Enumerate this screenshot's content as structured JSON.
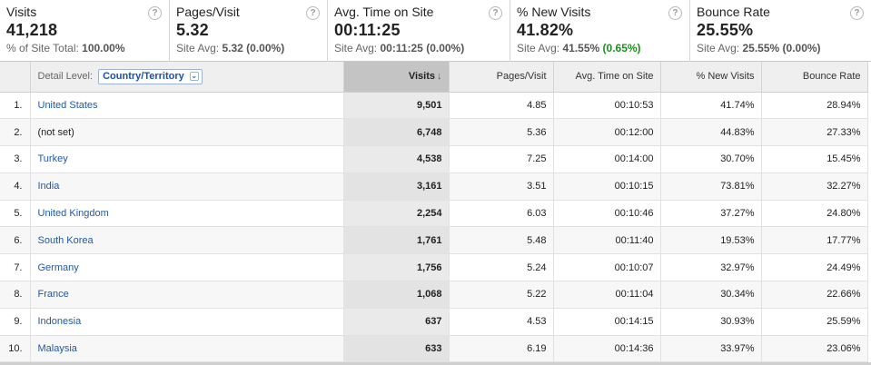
{
  "metrics": [
    {
      "label": "Visits",
      "value": "41,218",
      "sub_prefix": "% of Site Total: ",
      "sub_value": "100.00%",
      "sub_delta": ""
    },
    {
      "label": "Pages/Visit",
      "value": "5.32",
      "sub_prefix": "Site Avg: ",
      "sub_value": "5.32 (0.00%)",
      "sub_delta": ""
    },
    {
      "label": "Avg. Time on Site",
      "value": "00:11:25",
      "sub_prefix": "Site Avg: ",
      "sub_value": "00:11:25 (0.00%)",
      "sub_delta": ""
    },
    {
      "label": "% New Visits",
      "value": "41.82%",
      "sub_prefix": "Site Avg: ",
      "sub_value": "41.55%",
      "sub_delta": "(0.65%)"
    },
    {
      "label": "Bounce Rate",
      "value": "25.55%",
      "sub_prefix": "Site Avg: ",
      "sub_value": "25.55% (0.00%)",
      "sub_delta": ""
    }
  ],
  "help_glyph": "?",
  "table": {
    "detail_label": "Detail Level:",
    "detail_value": "Country/Territory",
    "sort_arrow": "↓",
    "columns": [
      "Visits",
      "Pages/Visit",
      "Avg. Time on Site",
      "% New Visits",
      "Bounce Rate"
    ],
    "rows": [
      {
        "index": "1.",
        "country": "United States",
        "is_link": true,
        "visits": "9,501",
        "pages_visit": "4.85",
        "avg_time": "00:10:53",
        "new_visits": "41.74%",
        "bounce_rate": "28.94%"
      },
      {
        "index": "2.",
        "country": "(not set)",
        "is_link": false,
        "visits": "6,748",
        "pages_visit": "5.36",
        "avg_time": "00:12:00",
        "new_visits": "44.83%",
        "bounce_rate": "27.33%"
      },
      {
        "index": "3.",
        "country": "Turkey",
        "is_link": true,
        "visits": "4,538",
        "pages_visit": "7.25",
        "avg_time": "00:14:00",
        "new_visits": "30.70%",
        "bounce_rate": "15.45%"
      },
      {
        "index": "4.",
        "country": "India",
        "is_link": true,
        "visits": "3,161",
        "pages_visit": "3.51",
        "avg_time": "00:10:15",
        "new_visits": "73.81%",
        "bounce_rate": "32.27%"
      },
      {
        "index": "5.",
        "country": "United Kingdom",
        "is_link": true,
        "visits": "2,254",
        "pages_visit": "6.03",
        "avg_time": "00:10:46",
        "new_visits": "37.27%",
        "bounce_rate": "24.80%"
      },
      {
        "index": "6.",
        "country": "South Korea",
        "is_link": true,
        "visits": "1,761",
        "pages_visit": "5.48",
        "avg_time": "00:11:40",
        "new_visits": "19.53%",
        "bounce_rate": "17.77%"
      },
      {
        "index": "7.",
        "country": "Germany",
        "is_link": true,
        "visits": "1,756",
        "pages_visit": "5.24",
        "avg_time": "00:10:07",
        "new_visits": "32.97%",
        "bounce_rate": "24.49%"
      },
      {
        "index": "8.",
        "country": "France",
        "is_link": true,
        "visits": "1,068",
        "pages_visit": "5.22",
        "avg_time": "00:11:04",
        "new_visits": "30.34%",
        "bounce_rate": "22.66%"
      },
      {
        "index": "9.",
        "country": "Indonesia",
        "is_link": true,
        "visits": "637",
        "pages_visit": "4.53",
        "avg_time": "00:14:15",
        "new_visits": "30.93%",
        "bounce_rate": "25.59%"
      },
      {
        "index": "10.",
        "country": "Malaysia",
        "is_link": true,
        "visits": "633",
        "pages_visit": "6.19",
        "avg_time": "00:14:36",
        "new_visits": "33.97%",
        "bounce_rate": "23.06%"
      }
    ]
  },
  "colors": {
    "link": "#1f5aa6",
    "delta_positive": "#1f8f1f",
    "sorted_header": "#c4c4c4"
  }
}
